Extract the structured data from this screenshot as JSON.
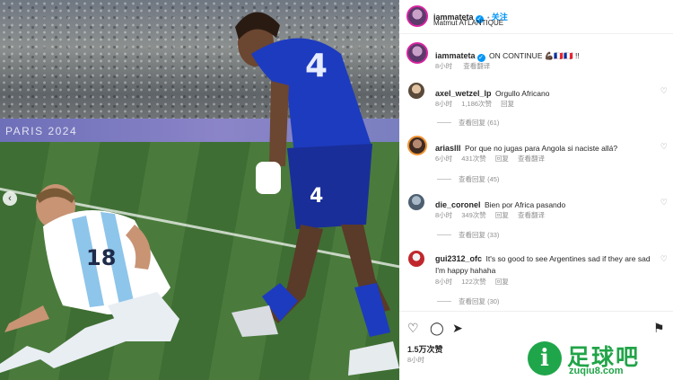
{
  "photo": {
    "board_text": "PARIS 2024",
    "prev_icon": "chevron-left-icon"
  },
  "post": {
    "username": "iammateta",
    "follow_label": "关注",
    "location": "Matmut ATLANTIQUE",
    "caption_user": "iammateta",
    "caption_text": "ON CONTINUE 💪🏿🇫🇷🇫🇷 !!",
    "caption_time": "8小时",
    "caption_translate": "查看翻译"
  },
  "comments": [
    {
      "user": "axel_wetzel_lp",
      "text": "Orgullo Africano",
      "time": "8小时",
      "likes": "1,186次赞",
      "reply": "回复",
      "translate": "",
      "view_replies": "查看回复 (61)"
    },
    {
      "user": "ariaslll",
      "text": "Por que no jugas para Angola si naciste allá?",
      "time": "6小时",
      "likes": "431次赞",
      "reply": "回复",
      "translate": "查看翻译",
      "view_replies": "查看回复 (45)"
    },
    {
      "user": "die_coronel",
      "text": "Bien por Africa pasando",
      "time": "8小时",
      "likes": "349次赞",
      "reply": "回复",
      "translate": "查看翻译",
      "view_replies": "查看回复 (33)"
    },
    {
      "user": "gui2312_ofc",
      "text": "It's so good to see Argentines sad if they are sad I'm happy hahaha",
      "time": "8小时",
      "likes": "122次赞",
      "reply": "回复",
      "translate": "",
      "view_replies": "查看回复 (30)"
    }
  ],
  "actions": {
    "likes": "1.5万次赞",
    "time": "8小时"
  },
  "watermark": {
    "cn": "足球吧",
    "url": "zuqiu8.com",
    "letter": "i"
  },
  "colors": {
    "accent": "#0095f6",
    "watermark_green": "#21a448",
    "france_blue": "#1d3bbf",
    "argentina_sky": "#8ec5ea"
  }
}
